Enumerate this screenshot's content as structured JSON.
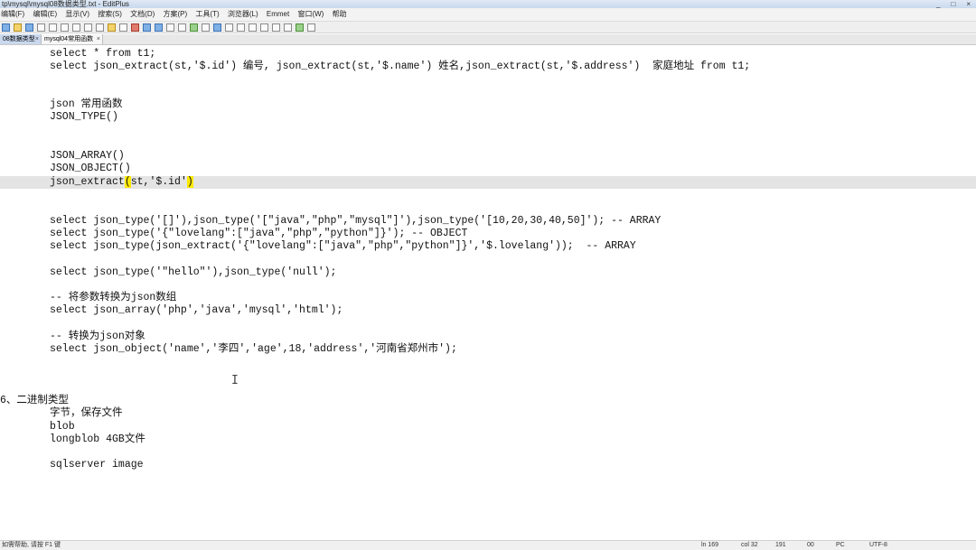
{
  "window": {
    "title": "tp\\mysql\\mysql08数据类型.txt - EditPlus",
    "controls": [
      "_",
      "□",
      "×"
    ]
  },
  "menu": [
    "编辑(F)",
    "编辑(E)",
    "显示(V)",
    "搜索(S)",
    "文档(D)",
    "方案(P)",
    "工具(T)",
    "浏览器(L)",
    "Emmet",
    "窗口(W)",
    "帮助"
  ],
  "tabs": [
    {
      "label": "08数据类型",
      "close": "×"
    },
    {
      "label": "mysql04常用函数",
      "close": "×"
    }
  ],
  "editor": {
    "lines": [
      {
        "text": "select * from t1;"
      },
      {
        "text": "select json_extract(st,'$.id') 编号, json_extract(st,'$.name') 姓名,json_extract(st,'$.address')  家庭地址 from t1;"
      },
      {
        "text": ""
      },
      {
        "text": ""
      },
      {
        "text": "json 常用函数"
      },
      {
        "text": "JSON_TYPE()"
      },
      {
        "text": ""
      },
      {
        "text": ""
      },
      {
        "text": "JSON_ARRAY()"
      },
      {
        "text": "JSON_OBJECT()"
      },
      {
        "text_pre": "json_extract",
        "text_b1": "(",
        "text_mid": "st,'$.id'",
        "text_b2": ")",
        "current": true
      },
      {
        "text": ""
      },
      {
        "text": ""
      },
      {
        "text": "select json_type('[]'),json_type('[\"java\",\"php\",\"mysql\"]'),json_type('[10,20,30,40,50]'); -- ARRAY"
      },
      {
        "text": "select json_type('{\"lovelang\":[\"java\",\"php\",\"python\"]}'); -- OBJECT"
      },
      {
        "text": "select json_type(json_extract('{\"lovelang\":[\"java\",\"php\",\"python\"]}','$.lovelang'));  -- ARRAY"
      },
      {
        "text": ""
      },
      {
        "text": "select json_type('\"hello\"'),json_type('null');"
      },
      {
        "text": ""
      },
      {
        "text": "-- 将参数转换为json数组"
      },
      {
        "text": "select json_array('php','java','mysql','html');"
      },
      {
        "text": ""
      },
      {
        "text": "-- 转换为json对象"
      },
      {
        "text": "select json_object('name','李四','age',18,'address','河南省郑州市');"
      },
      {
        "text": ""
      },
      {
        "text": ""
      },
      {
        "text": ""
      },
      {
        "text": "6、二进制类型",
        "outdent": true
      },
      {
        "text": "字节，保存文件"
      },
      {
        "text": "blob"
      },
      {
        "text": "longblob 4GB文件"
      },
      {
        "text": ""
      },
      {
        "text": "sqlserver image"
      }
    ],
    "mouse_cursor": "I"
  },
  "status": {
    "left": "如需帮助, 请按 F1 键",
    "ln": "ln 169",
    "col": "col 32",
    "num1": "191",
    "num2": "00",
    "mode": "PC",
    "encoding": "UTF-8"
  }
}
